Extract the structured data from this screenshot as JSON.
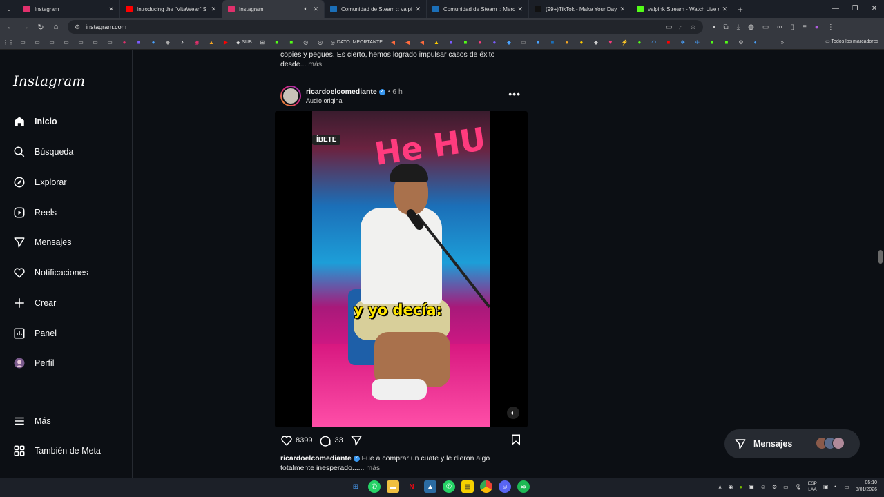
{
  "browser": {
    "tabs": [
      {
        "title": "Instagram",
        "color": "#e1306c",
        "active": false
      },
      {
        "title": "Introducing the \"VitaWear\" S",
        "color": "#ff0000",
        "active": false
      },
      {
        "title": "Instagram",
        "color": "#e1306c",
        "active": true
      },
      {
        "title": "Comunidad de Steam :: valpink",
        "color": "#1b6fb8",
        "active": false
      },
      {
        "title": "Comunidad de Steam :: Mercado",
        "color": "#1b6fb8",
        "active": false
      },
      {
        "title": "(99+)TikTok - Make Your Day",
        "color": "#111111",
        "active": false
      },
      {
        "title": "valpink Stream - Watch Live on",
        "color": "#53fc18",
        "active": false
      }
    ],
    "url": "instagram.com",
    "bookmarks": {
      "sub_label": "SUB",
      "dato_label": "DATO IMPORTANTE",
      "all_label": "Todos los marcadores"
    }
  },
  "instagram": {
    "logo": "Instagram",
    "nav": [
      {
        "label": "Inicio",
        "icon": "home-icon"
      },
      {
        "label": "Búsqueda",
        "icon": "search-icon"
      },
      {
        "label": "Explorar",
        "icon": "explore-icon"
      },
      {
        "label": "Reels",
        "icon": "reels-icon"
      },
      {
        "label": "Mensajes",
        "icon": "messages-icon"
      },
      {
        "label": "Notificaciones",
        "icon": "heart-icon"
      },
      {
        "label": "Crear",
        "icon": "plus-icon"
      },
      {
        "label": "Panel",
        "icon": "dashboard-icon"
      },
      {
        "label": "Perfil",
        "icon": "profile-avatar"
      }
    ],
    "more_label": "Más",
    "meta_label": "También de Meta"
  },
  "feed": {
    "prev_caption_line1": "copies y pegues. Es cierto, hemos logrado impulsar casos de éxito",
    "prev_caption_line2": "desde...",
    "more": "más",
    "post": {
      "username": "ricardoelcomediante",
      "time": "6 h",
      "audio": "Audio original",
      "video_caption": "y yo decía:",
      "video_badge": "ÍBETE",
      "brand_text": "He HU",
      "likes": "8399",
      "comments": "33",
      "caption_user": "ricardoelcomediante",
      "caption_text": "Fue a comprar un cuate y le dieron algo totalmente inesperado......",
      "caption_more": "más"
    }
  },
  "messages_pill": {
    "label": "Mensajes"
  },
  "taskbar": {
    "lang_line1": "ESP",
    "lang_line2": "LAA",
    "time": "05:10",
    "date": "8/01/2026"
  }
}
